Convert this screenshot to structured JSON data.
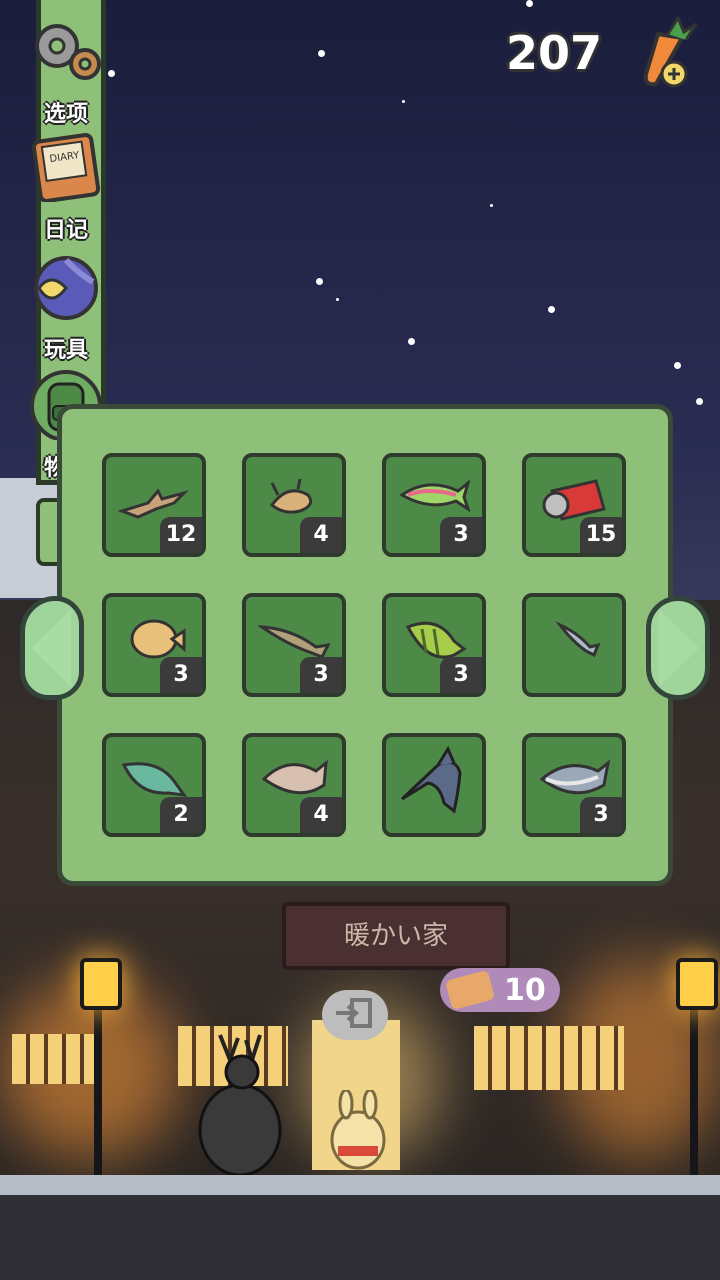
{
  "currency": {
    "amount": "207"
  },
  "side_menu": {
    "items": [
      {
        "label": "选项",
        "icon": "gears-icon"
      },
      {
        "label": "日记",
        "icon": "diary-icon"
      },
      {
        "label": "玩具",
        "icon": "toys-icon"
      },
      {
        "label": "物品",
        "icon": "backpack-icon"
      }
    ]
  },
  "inventory": {
    "items": [
      {
        "name": "driftwood",
        "count": "12"
      },
      {
        "name": "crab",
        "count": "4"
      },
      {
        "name": "rainbow-trout",
        "count": "3"
      },
      {
        "name": "crushed-can",
        "count": "15"
      },
      {
        "name": "flatfish",
        "count": "3"
      },
      {
        "name": "pike",
        "count": "3"
      },
      {
        "name": "perch",
        "count": "3"
      },
      {
        "name": "sardine",
        "count": ""
      },
      {
        "name": "grouper",
        "count": "2"
      },
      {
        "name": "flounder",
        "count": "4"
      },
      {
        "name": "swordfish",
        "count": ""
      },
      {
        "name": "tuna",
        "count": "3"
      }
    ]
  },
  "shop": {
    "sign_text": "暖かい家",
    "ticket_count": "10"
  },
  "colors": {
    "panel": "#8fc07a",
    "slot": "#4d8a48",
    "border": "#2e3a2c",
    "sky": "#1b1d3c"
  }
}
